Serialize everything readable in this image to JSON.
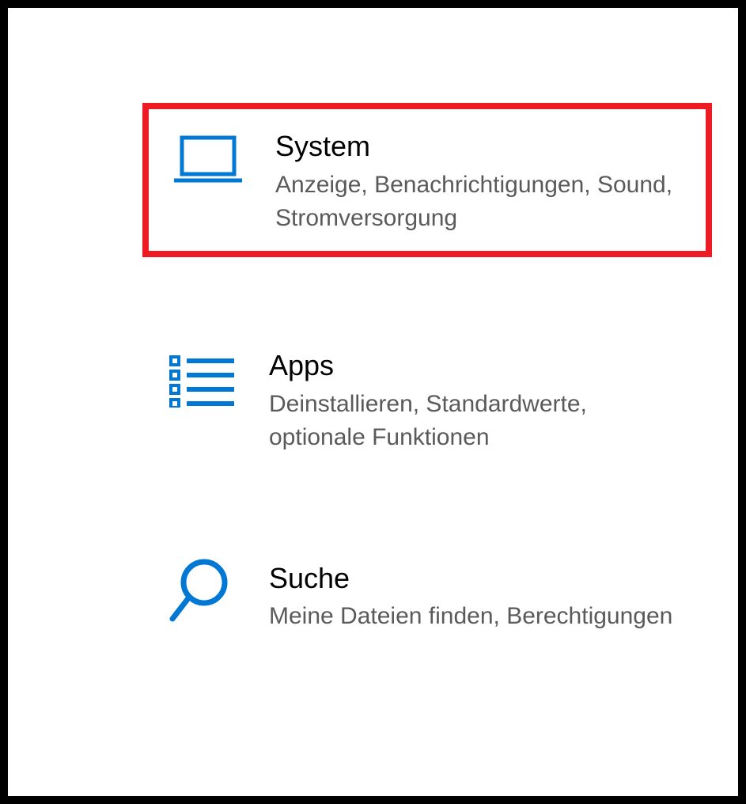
{
  "settings": {
    "tiles": [
      {
        "title": "System",
        "description": "Anzeige, Benachrichtigungen, Sound, Stromversorgung",
        "icon": "laptop",
        "highlighted": true
      },
      {
        "title": "Apps",
        "description": "Deinstallieren, Standardwerte, optionale Funktionen",
        "icon": "list",
        "highlighted": false
      },
      {
        "title": "Suche",
        "description": "Meine Dateien finden, Berechtigungen",
        "icon": "search",
        "highlighted": false
      }
    ]
  },
  "colors": {
    "accent": "#0078d4",
    "highlight_border": "#ed1c24",
    "text_primary": "#000000",
    "text_secondary": "#5a5a5a"
  }
}
